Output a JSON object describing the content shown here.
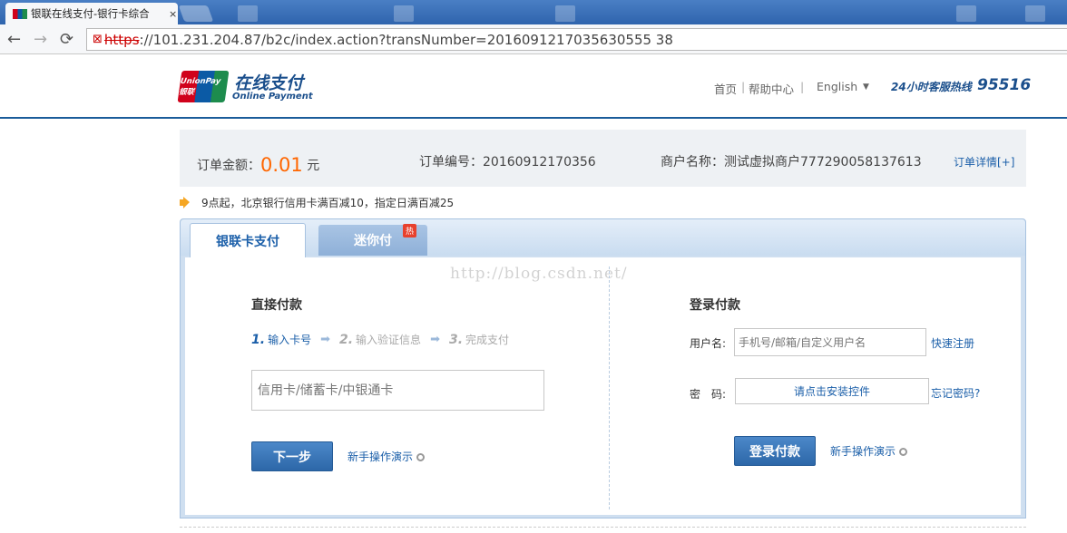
{
  "browser": {
    "tab_title": "银联在线支付-银行卡综合",
    "tab_close": "×",
    "url_scheme": "https",
    "url_rest": "://101.231.204.87/b2c/index.action?transNumber=2016091217035630555 38"
  },
  "header": {
    "logo_text": "UnionPay 银联",
    "logo_cn": "在线支付",
    "logo_en": "Online Payment",
    "nav_home": "首页",
    "nav_help": "帮助中心",
    "sep": "|",
    "lang": "English",
    "hotline_label": "24小时客服热线",
    "hotline_number": "95516"
  },
  "order": {
    "amount_label": "订单金额：",
    "amount_value": "0.01",
    "amount_unit": "元",
    "number_label": "订单编号：",
    "number_value": "20160912170356",
    "merchant_label": "商户名称：",
    "merchant_value": "测试虚拟商户777290058137613",
    "detail_link": "订单详情[+]"
  },
  "promo": {
    "text": "9点起，北京银行信用卡满百减10，指定日满百减25"
  },
  "tabs": {
    "card_pay": "银联卡支付",
    "mini_pay": "迷你付",
    "hot_badge": "热"
  },
  "watermark": "http://blog.csdn.net/",
  "direct": {
    "title": "直接付款",
    "steps": [
      {
        "num": "1.",
        "label": "输入卡号"
      },
      {
        "num": "2.",
        "label": "输入验证信息"
      },
      {
        "num": "3.",
        "label": "完成支付"
      }
    ],
    "step_arrow": "➡",
    "card_placeholder": "信用卡/储蓄卡/中银通卡",
    "next_button": "下一步",
    "guide_link": "新手操作演示"
  },
  "login": {
    "title": "登录付款",
    "username_label": "用户名:",
    "username_placeholder": "手机号/邮箱/自定义用户名",
    "register_link": "快速注册",
    "password_label": "密　码:",
    "install_control": "请点击安装控件",
    "forgot_link": "忘记密码?",
    "login_button": "登录付款",
    "guide_link": "新手操作演示"
  }
}
